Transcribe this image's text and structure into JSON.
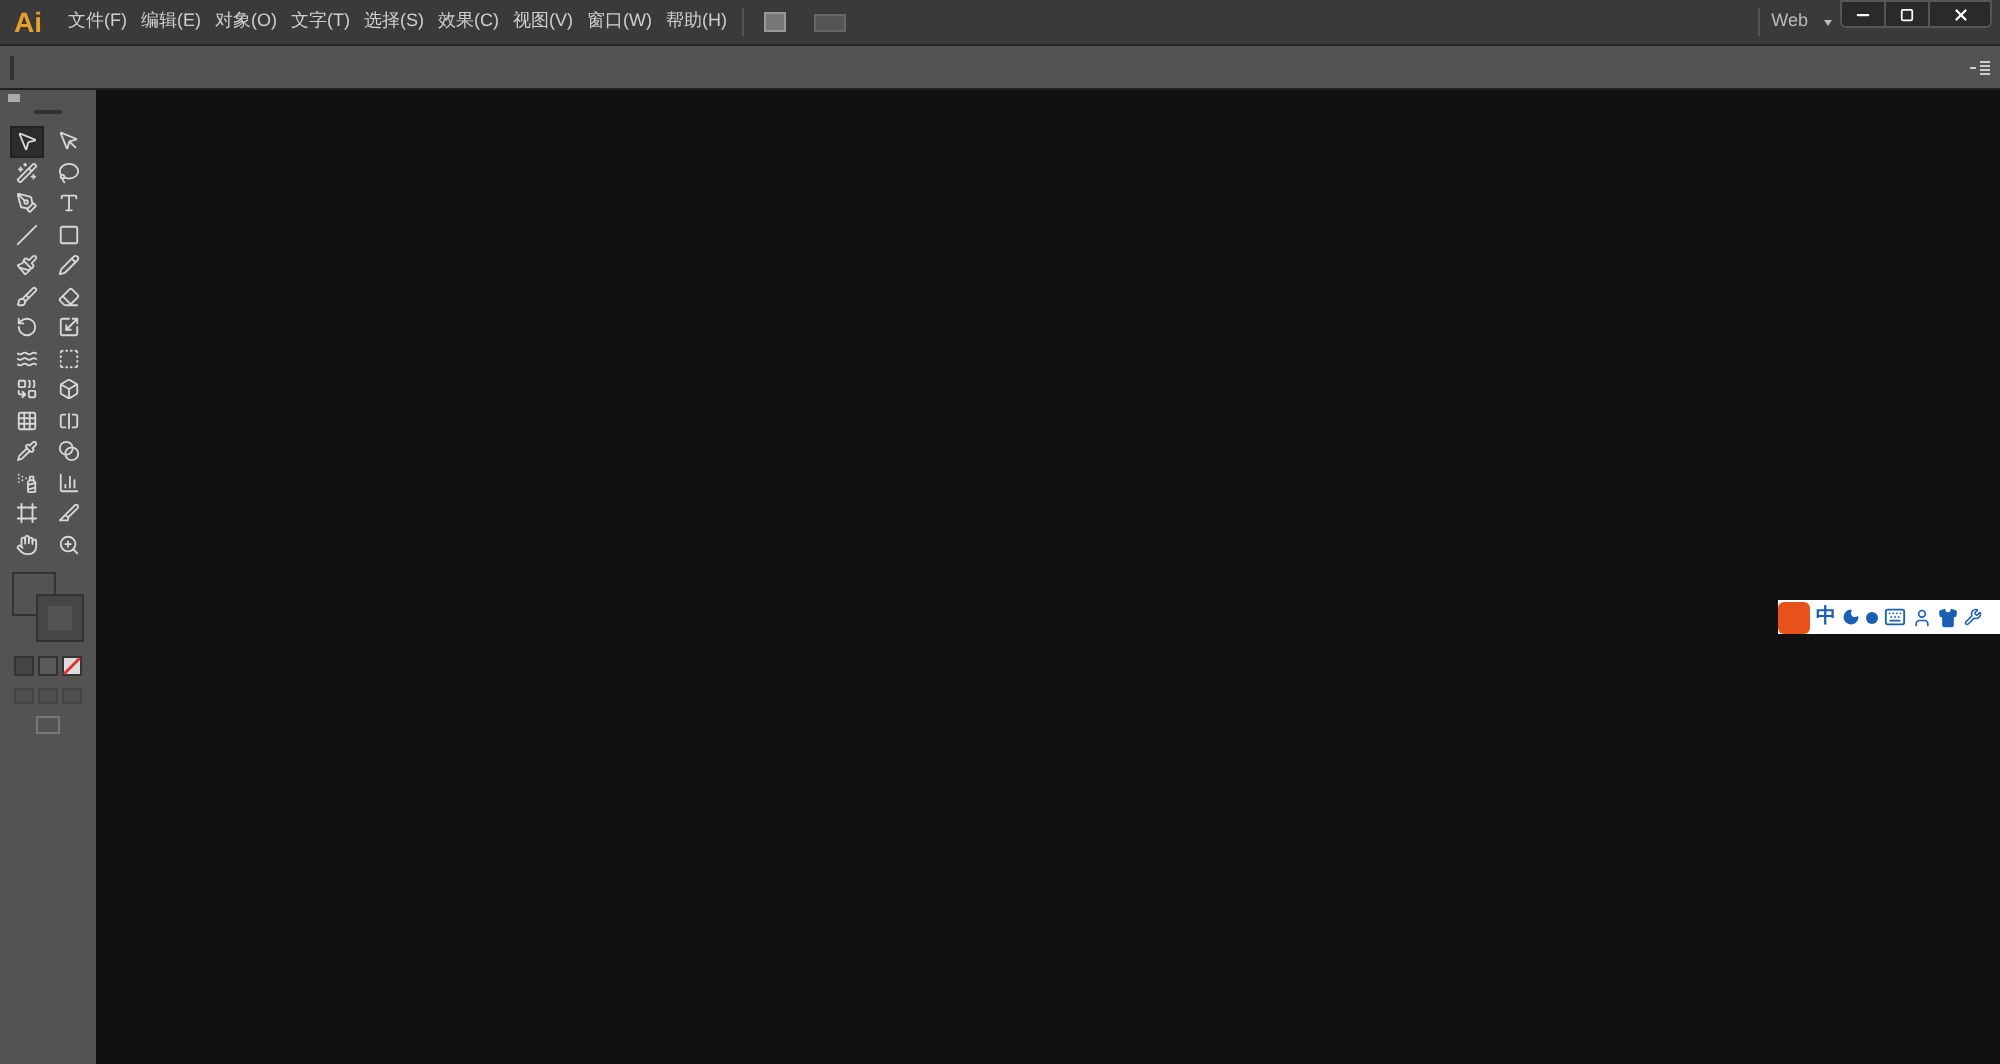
{
  "app_logo": "Ai",
  "menu": [
    "文件(F)",
    "编辑(E)",
    "对象(O)",
    "文字(T)",
    "选择(S)",
    "效果(C)",
    "视图(V)",
    "窗口(W)",
    "帮助(H)"
  ],
  "workspace": "Web",
  "tools": [
    {
      "kind": "selection",
      "selected": true
    },
    {
      "kind": "direct",
      "selected": false
    },
    {
      "kind": "wand",
      "selected": false
    },
    {
      "kind": "lasso",
      "selected": false
    },
    {
      "kind": "pen",
      "selected": false
    },
    {
      "kind": "type",
      "selected": false
    },
    {
      "kind": "line",
      "selected": false
    },
    {
      "kind": "rect",
      "selected": false
    },
    {
      "kind": "brush",
      "selected": false
    },
    {
      "kind": "pencil",
      "selected": false
    },
    {
      "kind": "blob",
      "selected": false
    },
    {
      "kind": "eraser",
      "selected": false
    },
    {
      "kind": "rotate",
      "selected": false
    },
    {
      "kind": "scale",
      "selected": false
    },
    {
      "kind": "warp",
      "selected": false
    },
    {
      "kind": "transform",
      "selected": false
    },
    {
      "kind": "builder",
      "selected": false
    },
    {
      "kind": "perspective",
      "selected": false
    },
    {
      "kind": "mesh",
      "selected": false
    },
    {
      "kind": "gradient",
      "selected": false
    },
    {
      "kind": "eyedropper",
      "selected": false
    },
    {
      "kind": "blend",
      "selected": false
    },
    {
      "kind": "sprayer",
      "selected": false
    },
    {
      "kind": "graph",
      "selected": false
    },
    {
      "kind": "artboard",
      "selected": false
    },
    {
      "kind": "slice",
      "selected": false
    },
    {
      "kind": "hand",
      "selected": false
    },
    {
      "kind": "zoom",
      "selected": false
    }
  ],
  "ime": {
    "label": "中"
  }
}
